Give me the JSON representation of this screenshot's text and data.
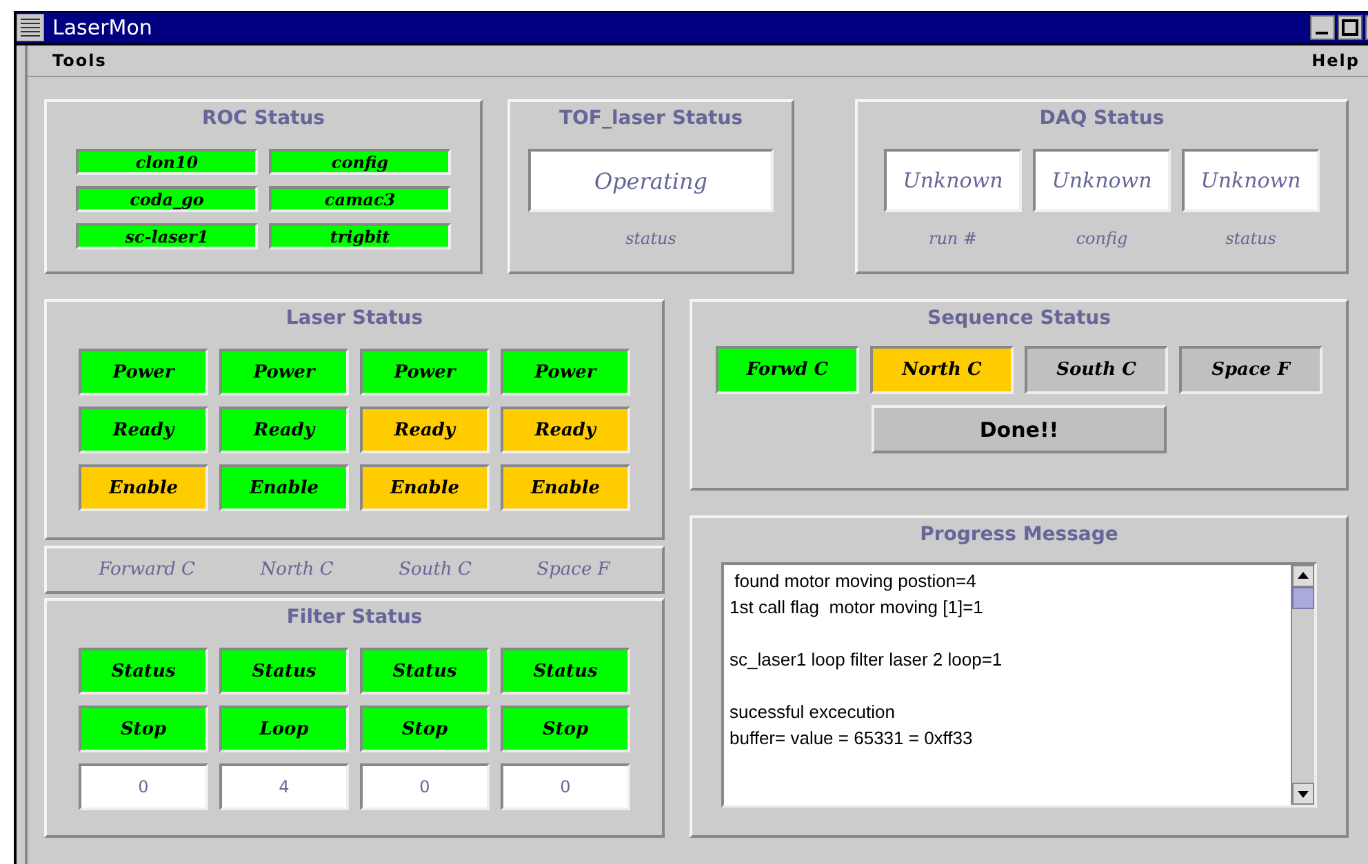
{
  "window": {
    "title": "LaserMon"
  },
  "menu": [
    {
      "label": "Tools"
    },
    {
      "label": "Help"
    }
  ],
  "roc_status": {
    "title": "ROC Status",
    "items": [
      {
        "label": "clon10",
        "color": "#00ff00"
      },
      {
        "label": "config",
        "color": "#00ff00"
      },
      {
        "label": "coda_go",
        "color": "#00ff00"
      },
      {
        "label": "camac3",
        "color": "#00ff00"
      },
      {
        "label": "sc-laser1",
        "color": "#00ff00"
      },
      {
        "label": "trigbit",
        "color": "#00ff00"
      }
    ]
  },
  "tof_laser_status": {
    "title": "TOF_laser Status",
    "value": "Operating",
    "caption": "status"
  },
  "daq_status": {
    "title": "DAQ Status",
    "fields": [
      {
        "value": "Unknown",
        "caption": "run #"
      },
      {
        "value": "Unknown",
        "caption": "config"
      },
      {
        "value": "Unknown",
        "caption": "status"
      }
    ]
  },
  "laser_status": {
    "title": "Laser Status",
    "rows": [
      {
        "cells": [
          {
            "label": "Power",
            "color": "#00ff00"
          },
          {
            "label": "Power",
            "color": "#00ff00"
          },
          {
            "label": "Power",
            "color": "#00ff00"
          },
          {
            "label": "Power",
            "color": "#00ff00"
          }
        ]
      },
      {
        "cells": [
          {
            "label": "Ready",
            "color": "#00ff00"
          },
          {
            "label": "Ready",
            "color": "#00ff00"
          },
          {
            "label": "Ready",
            "color": "#ffcc00"
          },
          {
            "label": "Ready",
            "color": "#ffcc00"
          }
        ]
      },
      {
        "cells": [
          {
            "label": "Enable",
            "color": "#ffcc00"
          },
          {
            "label": "Enable",
            "color": "#00ff00"
          },
          {
            "label": "Enable",
            "color": "#ffcc00"
          },
          {
            "label": "Enable",
            "color": "#ffcc00"
          }
        ]
      }
    ]
  },
  "channel_labels": [
    "Forward C",
    "North C",
    "South C",
    "Space F"
  ],
  "filter_status": {
    "title": "Filter Status",
    "rows": [
      {
        "cells": [
          {
            "label": "Status",
            "color": "#00ff00"
          },
          {
            "label": "Status",
            "color": "#00ff00"
          },
          {
            "label": "Status",
            "color": "#00ff00"
          },
          {
            "label": "Status",
            "color": "#00ff00"
          }
        ]
      },
      {
        "cells": [
          {
            "label": "Stop",
            "color": "#00ff00"
          },
          {
            "label": "Loop",
            "color": "#00ff00"
          },
          {
            "label": "Stop",
            "color": "#00ff00"
          },
          {
            "label": "Stop",
            "color": "#00ff00"
          }
        ]
      }
    ],
    "counts": [
      "0",
      "4",
      "0",
      "0"
    ]
  },
  "sequence_status": {
    "title": "Sequence Status",
    "steps": [
      {
        "label": "Forwd C",
        "color": "#00ff00"
      },
      {
        "label": "North C",
        "color": "#ffcc00"
      },
      {
        "label": "South C",
        "color": "#c0c0c0"
      },
      {
        "label": "Space F",
        "color": "#c0c0c0"
      }
    ],
    "done_button": "Done!!"
  },
  "progress_message": {
    "title": "Progress Message",
    "text": " found motor moving postion=4\n1st call flag  motor moving [1]=1\n\nsc_laser1 loop filter laser 2 loop=1\n\nsucessful excecution\nbuffer= value = 65331 = 0xff33"
  }
}
